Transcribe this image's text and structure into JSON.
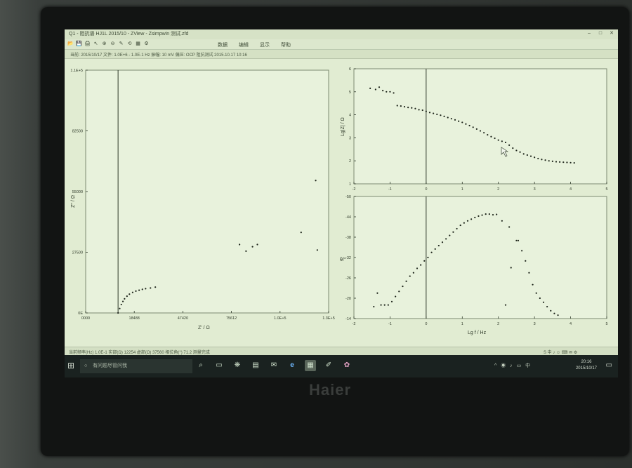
{
  "window": {
    "title": "Q1 - 阻抗谱 HJ1L 2015/10 - ZView - Zsimpwin 测试.zfd",
    "controls": [
      "–",
      "□",
      "✕"
    ]
  },
  "toolbar": {
    "tools": [
      "📂",
      "💾",
      "🖨",
      "↖",
      "⊕",
      "⊖",
      "✎",
      "⟲",
      "▦",
      "⚙"
    ],
    "menus": [
      "数据",
      "编辑",
      "显示",
      "帮助"
    ]
  },
  "infobar": {
    "text": "当前: 2015/10/17   文件: 1.0E+6 - 1.0E-1 Hz   振幅: 10 mV   偏压: OCP   阻抗测试 2015.10.17 10:16"
  },
  "status": {
    "text": "当前频率(Hz) 1.0E-1   实部(Ω) 12254   虚部(Ω) 37560   相位角(°) 71.2   测量完成"
  },
  "ime": {
    "text": "S 中 ♪ ☺ ⌨ ✉ ⚙"
  },
  "taskbar": {
    "start_icon": "windows-logo-icon",
    "search_placeholder": "有问题尽管问我",
    "apps": [
      "⌕",
      "▭",
      "❋",
      "▤",
      "✉",
      "e",
      "▦",
      "✐",
      "✿"
    ],
    "tray_icons": "^ ◉ ♪ ▭ 中",
    "time": "20:16",
    "date": "2015/10/17"
  },
  "monitor": {
    "brand": "Haier"
  },
  "chart_data": [
    {
      "type": "scatter",
      "title": "",
      "xlabel": "Z' / Ω",
      "ylabel": "Z'' / Ω",
      "x_ticks": [
        "0000",
        "18488",
        "47420",
        "75612",
        "1.0E+5",
        "1.3E+5"
      ],
      "y_ticks": [
        "0E",
        "27500",
        "55000",
        "82500",
        "1.1E+5"
      ],
      "xlim": [
        -20000,
        130000
      ],
      "ylim": [
        0,
        110000
      ],
      "points": [
        [
          0,
          0
        ],
        [
          1000,
          2000
        ],
        [
          2000,
          3800
        ],
        [
          3000,
          5200
        ],
        [
          4000,
          6400
        ],
        [
          5500,
          7600
        ],
        [
          7000,
          8500
        ],
        [
          9000,
          9300
        ],
        [
          11000,
          9900
        ],
        [
          13000,
          10300
        ],
        [
          15000,
          10700
        ],
        [
          17000,
          11000
        ],
        [
          20000,
          11300
        ],
        [
          23000,
          11700
        ],
        [
          75000,
          31000
        ],
        [
          79000,
          28000
        ],
        [
          83000,
          30000
        ],
        [
          86000,
          31000
        ],
        [
          113000,
          36500
        ],
        [
          122000,
          60000
        ],
        [
          123000,
          28500
        ]
      ]
    },
    {
      "type": "scatter",
      "title": "",
      "xlabel": "",
      "ylabel": "Lg|Z| / Ω",
      "x_ticks": [
        "-2",
        "-1",
        "0",
        "1",
        "2",
        "3",
        "4",
        "5"
      ],
      "y_ticks": [
        "1",
        "2",
        "3",
        "4",
        "5",
        "6"
      ],
      "xlim": [
        -2,
        5
      ],
      "ylim": [
        1,
        6
      ],
      "points": [
        [
          -1.55,
          5.15
        ],
        [
          -1.4,
          5.1
        ],
        [
          -1.3,
          5.2
        ],
        [
          -1.2,
          5.05
        ],
        [
          -1.1,
          5.0
        ],
        [
          -1.0,
          5.0
        ],
        [
          -0.9,
          4.95
        ],
        [
          -0.8,
          4.4
        ],
        [
          -0.7,
          4.38
        ],
        [
          -0.6,
          4.35
        ],
        [
          -0.5,
          4.32
        ],
        [
          -0.4,
          4.3
        ],
        [
          -0.3,
          4.27
        ],
        [
          -0.2,
          4.22
        ],
        [
          -0.1,
          4.2
        ],
        [
          0.0,
          4.15
        ],
        [
          0.1,
          4.1
        ],
        [
          0.2,
          4.06
        ],
        [
          0.3,
          4.02
        ],
        [
          0.4,
          3.98
        ],
        [
          0.5,
          3.93
        ],
        [
          0.6,
          3.88
        ],
        [
          0.7,
          3.83
        ],
        [
          0.8,
          3.78
        ],
        [
          0.9,
          3.72
        ],
        [
          1.0,
          3.67
        ],
        [
          1.1,
          3.6
        ],
        [
          1.2,
          3.53
        ],
        [
          1.3,
          3.46
        ],
        [
          1.4,
          3.38
        ],
        [
          1.5,
          3.3
        ],
        [
          1.6,
          3.22
        ],
        [
          1.7,
          3.13
        ],
        [
          1.8,
          3.05
        ],
        [
          1.9,
          2.98
        ],
        [
          2.0,
          2.9
        ],
        [
          2.1,
          2.85
        ],
        [
          2.2,
          2.8
        ],
        [
          2.3,
          2.68
        ],
        [
          2.4,
          2.55
        ],
        [
          2.5,
          2.45
        ],
        [
          2.6,
          2.38
        ],
        [
          2.7,
          2.3
        ],
        [
          2.8,
          2.25
        ],
        [
          2.9,
          2.2
        ],
        [
          3.0,
          2.15
        ],
        [
          3.1,
          2.1
        ],
        [
          3.2,
          2.06
        ],
        [
          3.3,
          2.03
        ],
        [
          3.4,
          2.0
        ],
        [
          3.5,
          1.98
        ],
        [
          3.6,
          1.96
        ],
        [
          3.7,
          1.95
        ],
        [
          3.8,
          1.94
        ],
        [
          3.9,
          1.93
        ],
        [
          4.0,
          1.92
        ],
        [
          4.1,
          1.91
        ]
      ]
    },
    {
      "type": "scatter",
      "title": "",
      "xlabel": "Lg f / Hz",
      "ylabel": "θ/°",
      "x_ticks": [
        "-2",
        "-1",
        "0",
        "1",
        "2",
        "3",
        "4",
        "5"
      ],
      "y_ticks": [
        "-14",
        "-20",
        "-26",
        "-32",
        "-38",
        "-44",
        "-50"
      ],
      "xlim": [
        -2,
        5
      ],
      "ylim": [
        -14,
        -50
      ],
      "points": [
        [
          -1.45,
          -17.5
        ],
        [
          -1.35,
          -21.5
        ],
        [
          -1.25,
          -18.0
        ],
        [
          -1.15,
          -18.0
        ],
        [
          -1.05,
          -18.0
        ],
        [
          -0.95,
          -19.0
        ],
        [
          -0.85,
          -20.5
        ],
        [
          -0.75,
          -22.0
        ],
        [
          -0.65,
          -23.5
        ],
        [
          -0.55,
          -25.0
        ],
        [
          -0.45,
          -26.5
        ],
        [
          -0.35,
          -27.5
        ],
        [
          -0.25,
          -28.8
        ],
        [
          -0.15,
          -29.8
        ],
        [
          -0.05,
          -31.0
        ],
        [
          0.05,
          -32.0
        ],
        [
          0.15,
          -33.5
        ],
        [
          0.25,
          -34.5
        ],
        [
          0.35,
          -35.5
        ],
        [
          0.45,
          -36.5
        ],
        [
          0.55,
          -37.5
        ],
        [
          0.65,
          -38.5
        ],
        [
          0.75,
          -39.5
        ],
        [
          0.85,
          -40.5
        ],
        [
          0.95,
          -41.5
        ],
        [
          1.05,
          -42.2
        ],
        [
          1.15,
          -42.8
        ],
        [
          1.25,
          -43.3
        ],
        [
          1.35,
          -43.8
        ],
        [
          1.45,
          -44.2
        ],
        [
          1.55,
          -44.5
        ],
        [
          1.65,
          -44.8
        ],
        [
          1.75,
          -44.8
        ],
        [
          1.85,
          -44.6
        ],
        [
          1.95,
          -44.7
        ],
        [
          2.1,
          -42.8
        ],
        [
          2.3,
          -41.0
        ],
        [
          2.5,
          -37.0
        ],
        [
          2.55,
          -37.0
        ],
        [
          2.65,
          -34.0
        ],
        [
          2.75,
          -31.0
        ],
        [
          2.85,
          -27.5
        ],
        [
          2.95,
          -24.0
        ],
        [
          3.05,
          -21.5
        ],
        [
          3.15,
          -20.0
        ],
        [
          3.25,
          -18.8
        ],
        [
          3.35,
          -17.5
        ],
        [
          3.45,
          -16.3
        ],
        [
          3.55,
          -15.5
        ],
        [
          3.65,
          -15.0
        ],
        [
          2.2,
          -18.0
        ],
        [
          2.35,
          -29.0
        ]
      ]
    }
  ]
}
